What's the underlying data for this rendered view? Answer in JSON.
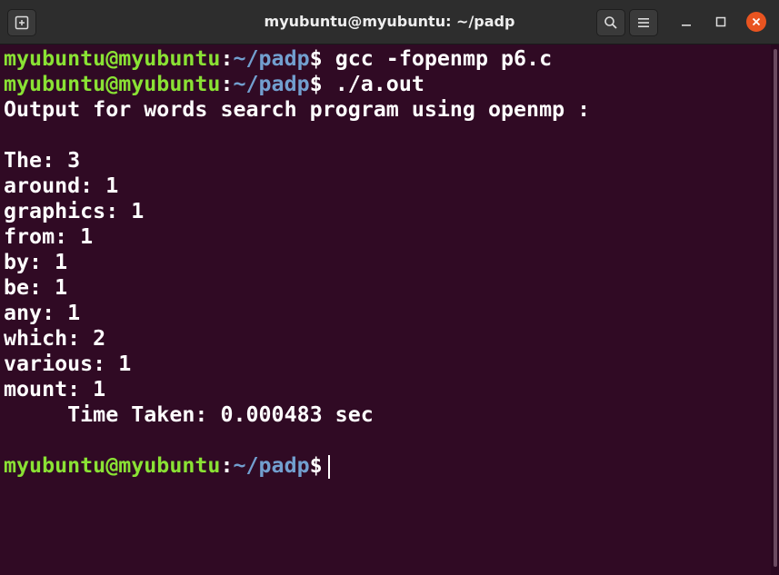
{
  "window": {
    "title": "myubuntu@myubuntu: ~/padp",
    "icons": {
      "new_tab": "new-tab-icon",
      "search": "search-icon",
      "menu": "hamburger-menu-icon",
      "minimize": "minimize-icon",
      "maximize": "maximize-icon",
      "close": "close-icon"
    },
    "accent_close": "#e95420"
  },
  "terminal": {
    "colors": {
      "background": "#300a24",
      "user": "#8ae234",
      "path": "#729fcf",
      "text": "#ffffff"
    },
    "prompt_user": "myubuntu@myubuntu",
    "prompt_sep": ":",
    "prompt_path": "~/padp",
    "prompt_sigil": "$",
    "commands": [
      " gcc -fopenmp p6.c",
      " ./a.out"
    ],
    "output_header": "Output for words search program using openmp :",
    "word_counts": [
      "The: 3",
      "around: 1",
      "graphics: 1",
      "from: 1",
      "by: 1",
      "be: 1",
      "any: 1",
      "which: 2",
      "various: 1",
      "mount: 1"
    ],
    "time_line": "     Time Taken: 0.000483 sec"
  }
}
